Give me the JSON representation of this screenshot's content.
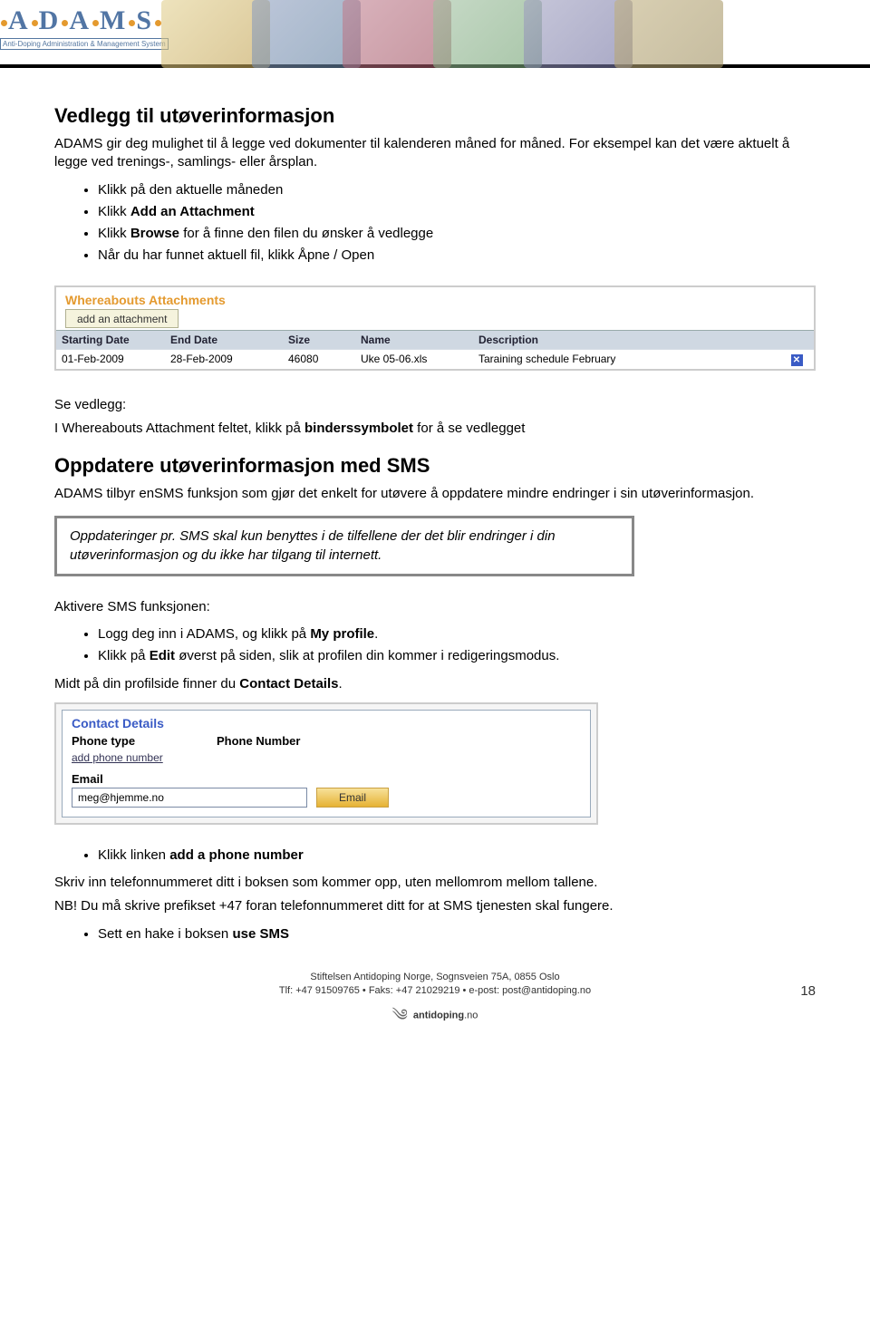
{
  "header": {
    "logo_main": "ADAMS",
    "logo_sub": "Anti-Doping Administration & Management System"
  },
  "section1": {
    "title": "Vedlegg til utøverinformasjon",
    "intro": "ADAMS gir deg mulighet til å legge ved dokumenter til kalenderen måned for måned. For eksempel kan det være aktuelt å legge ved trenings-, samlings- eller årsplan.",
    "bullets": [
      {
        "pre": "Klikk på den aktuelle måneden",
        "bold": "",
        "post": ""
      },
      {
        "pre": "Klikk ",
        "bold": "Add an Attachment",
        "post": ""
      },
      {
        "pre": "Klikk ",
        "bold": "Browse",
        "post": " for å finne den filen du ønsker å vedlegge"
      },
      {
        "pre": "Når du har funnet aktuell fil, klikk Åpne / Open",
        "bold": "",
        "post": ""
      }
    ]
  },
  "wa": {
    "title": "Whereabouts Attachments",
    "tab": "add an attachment",
    "headers": {
      "start": "Starting Date",
      "end": "End Date",
      "size": "Size",
      "name": "Name",
      "desc": "Description"
    },
    "row": {
      "start": "01-Feb-2009",
      "end": "28-Feb-2009",
      "size": "46080",
      "name": "Uke 05-06.xls",
      "desc": "Taraining schedule February"
    }
  },
  "seeattach": {
    "line1": "Se vedlegg:",
    "line2_pre": "I Whereabouts Attachment feltet, klikk på ",
    "line2_bold": "binderssymbolet",
    "line2_post": " for å se vedlegget"
  },
  "section2": {
    "title": "Oppdatere utøverinformasjon med SMS",
    "intro": "ADAMS tilbyr enSMS funksjon som gjør det enkelt for utøvere å oppdatere mindre endringer i sin utøverinformasjon.",
    "note": "Oppdateringer pr. SMS skal kun benyttes i de tilfellene der det blir endringer i din utøverinformasjon og du ikke har tilgang til internett.",
    "aktiver_title": "Aktivere SMS funksjonen:",
    "bullets": [
      {
        "pre": "Logg deg inn i ADAMS, og klikk på ",
        "bold": "My profile",
        "post": "."
      },
      {
        "pre": "Klikk på ",
        "bold": "Edit",
        "post": " øverst på siden, slik at profilen din kommer i redigeringsmodus."
      }
    ],
    "midt_pre": "Midt på din profilside finner du ",
    "midt_bold": "Contact Details",
    "midt_post": "."
  },
  "cd": {
    "title": "Contact Details",
    "phone_type": "Phone type",
    "phone_number": "Phone Number",
    "link": "add phone number",
    "email_label": "Email",
    "email_value": "meg@hjemme.no",
    "email_btn": "Email"
  },
  "section3": {
    "bullet_pre": "Klikk linken ",
    "bullet_bold": "add a phone number",
    "line1": "Skriv inn telefonnummeret ditt i boksen som kommer opp, uten mellomrom mellom tallene.",
    "line2": "NB! Du må skrive prefikset +47 foran telefonnummeret ditt for at SMS tjenesten skal fungere.",
    "bullet2_pre": "Sett en hake i boksen ",
    "bullet2_bold": "use SMS"
  },
  "footer": {
    "line1": "Stiftelsen Antidoping Norge, Sognsveien 75A, 0855 Oslo",
    "line2": "Tlf: +47 91509765 • Faks: +47 21029219 • e-post: post@antidoping.no",
    "page": "18",
    "brand": "antidoping",
    "brand_suffix": ".no"
  }
}
